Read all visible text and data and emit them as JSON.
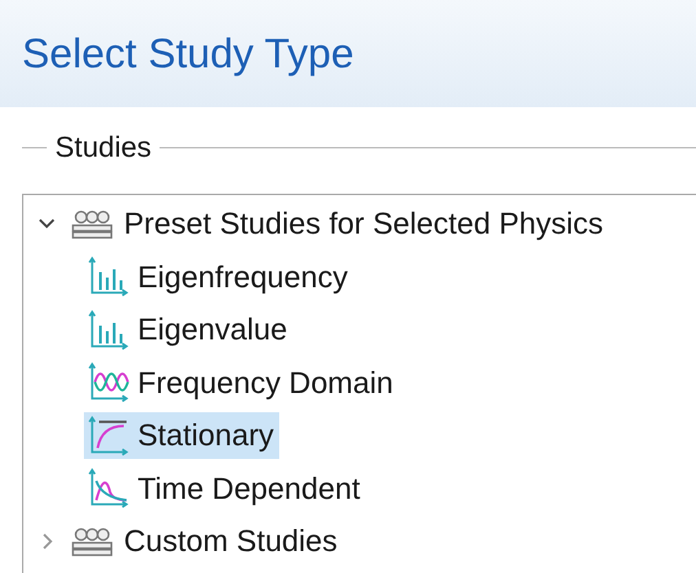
{
  "header": {
    "title": "Select Study Type"
  },
  "group": {
    "label": "Studies"
  },
  "tree": [
    {
      "label": "Preset Studies for Selected Physics",
      "kind": "folder",
      "expanded": true,
      "selected": false,
      "children": [
        {
          "label": "Eigenfrequency",
          "kind": "bars",
          "selected": false
        },
        {
          "label": "Eigenvalue",
          "kind": "bars",
          "selected": false
        },
        {
          "label": "Frequency Domain",
          "kind": "wave",
          "selected": false
        },
        {
          "label": "Stationary",
          "kind": "curve",
          "selected": true
        },
        {
          "label": "Time Dependent",
          "kind": "peak",
          "selected": false
        }
      ]
    },
    {
      "label": "Custom Studies",
      "kind": "folder",
      "expanded": false,
      "selected": false
    }
  ]
}
